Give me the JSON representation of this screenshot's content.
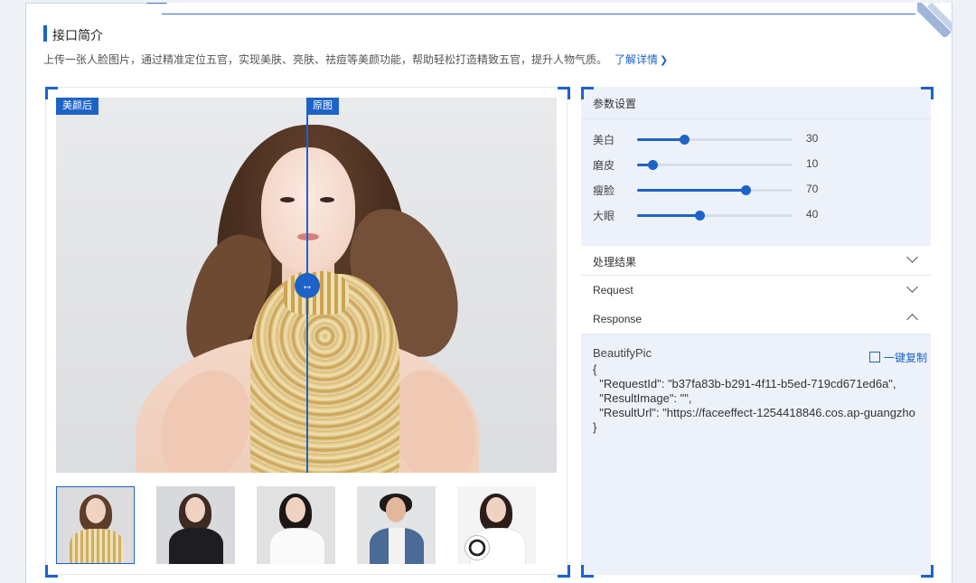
{
  "intro": {
    "title": "接口简介",
    "description": "上传一张人脸图片，通过精准定位五官，实现美肤、亮肤、祛痘等美颜功能，帮助轻松打造精致五官，提升人物气质。",
    "more_link": "了解详情"
  },
  "preview": {
    "tag_after": "美颜后",
    "tag_before": "原图",
    "handle_icon": "↔",
    "thumbnails": [
      "thumb-woman-gold-dress",
      "thumb-woman-black-top",
      "thumb-woman-white-shirt",
      "thumb-man-denim",
      "thumb-woman-soccer-ball"
    ]
  },
  "params": {
    "title": "参数设置",
    "sliders": [
      {
        "label": "美白",
        "value": "30",
        "level": 0.3
      },
      {
        "label": "磨皮",
        "value": "10",
        "level": 0.1
      },
      {
        "label": "瘦脸",
        "value": "70",
        "level": 0.7
      },
      {
        "label": "大眼",
        "value": "40",
        "level": 0.4
      }
    ]
  },
  "accordions": [
    {
      "label": "处理结果",
      "state": "collapsed"
    },
    {
      "label": "Request",
      "state": "collapsed"
    },
    {
      "label": "Response",
      "state": "expanded"
    }
  ],
  "response": {
    "name": "BeautifyPic",
    "copy_label": "一键复制",
    "code": "{\n  \"RequestId\": \"b37fa83b-b291-4f11-b5ed-719cd671ed6a\",\n  \"ResultImage\": \"\",\n  \"ResultUrl\": \"https://faceeffect-1254418846.cos.ap-guangzho\n}"
  },
  "colors": {
    "accent": "#1d63c7"
  }
}
